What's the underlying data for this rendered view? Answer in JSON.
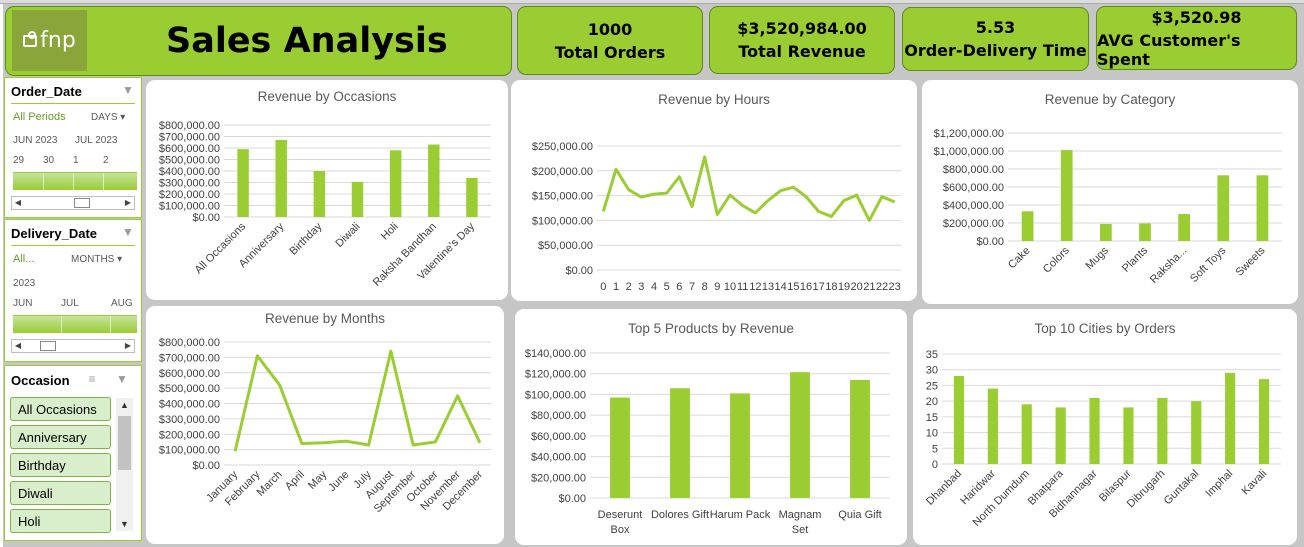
{
  "title": "Sales Analysis",
  "logo_text": "fnp",
  "colors": {
    "accent": "#9acd32",
    "line": "#9acd32",
    "panel": "#ffffff",
    "background": "#c6c6c6"
  },
  "kpis": [
    {
      "value": "1000",
      "label": "Total Orders"
    },
    {
      "value": "$3,520,984.00",
      "label": "Total Revenue"
    },
    {
      "value": "5.53",
      "label": "Order-Delivery Time"
    },
    {
      "value": "$3,520.98",
      "label": "AVG Customer's Spent"
    }
  ],
  "slicers": {
    "order_date": {
      "title": "Order_Date",
      "period": "All Periods",
      "unit": "DAYS",
      "months": [
        "JUN 2023",
        "JUL 2023"
      ],
      "days": [
        "29",
        "30",
        "1",
        "2"
      ]
    },
    "delivery_date": {
      "title": "Delivery_Date",
      "period": "All...",
      "unit": "MONTHS",
      "year": "2023",
      "months": [
        "JUN",
        "JUL",
        "AUG"
      ]
    },
    "occasion": {
      "title": "Occasion",
      "items": [
        "All Occasions",
        "Anniversary",
        "Birthday",
        "Diwali",
        "Holi"
      ]
    }
  },
  "chart_data": [
    {
      "type": "bar",
      "title": "Revenue by Occasions",
      "categories": [
        "All Occasions",
        "Anniversary",
        "Birthday",
        "Diwali",
        "Holi",
        "Raksha Bandhan",
        "Valentine's Day"
      ],
      "values": [
        590000,
        670000,
        400000,
        305000,
        580000,
        630000,
        340000
      ],
      "ylim": [
        0,
        800000
      ],
      "yticks": [
        "$0.00",
        "$100,000.00",
        "$200,000.00",
        "$300,000.00",
        "$400,000.00",
        "$500,000.00",
        "$600,000.00",
        "$700,000.00",
        "$800,000.00"
      ]
    },
    {
      "type": "line",
      "title": "Revenue by Hours",
      "x": [
        "0",
        "1",
        "2",
        "3",
        "4",
        "5",
        "6",
        "7",
        "8",
        "9",
        "10",
        "11",
        "12",
        "13",
        "14",
        "15",
        "16",
        "17",
        "18",
        "19",
        "20",
        "21",
        "22",
        "23"
      ],
      "values": [
        118000,
        203000,
        162000,
        147000,
        153000,
        155000,
        188000,
        128000,
        228000,
        112000,
        151000,
        130000,
        115000,
        140000,
        160000,
        167000,
        148000,
        118000,
        108000,
        140000,
        151000,
        100000,
        148000,
        137000
      ],
      "ylim": [
        0,
        250000
      ],
      "yticks": [
        "$0.00",
        "$50,000.00",
        "$100,000.00",
        "$150,000.00",
        "$200,000.00",
        "$250,000.00"
      ]
    },
    {
      "type": "bar",
      "title": "Revenue by Category",
      "categories": [
        "Cake",
        "Colors",
        "Mugs",
        "Plants",
        "Raksha...",
        "Soft Toys",
        "Sweets"
      ],
      "values": [
        330000,
        1010000,
        190000,
        195000,
        300000,
        730000,
        730000
      ],
      "ylim": [
        0,
        1200000
      ],
      "yticks": [
        "$0.00",
        "$200,000.00",
        "$400,000.00",
        "$600,000.00",
        "$800,000.00",
        "$1,000,000.00",
        "$1,200,000.00"
      ]
    },
    {
      "type": "line",
      "title": "Revenue by Months",
      "x": [
        "January",
        "February",
        "March",
        "April",
        "May",
        "June",
        "July",
        "August",
        "September",
        "October",
        "November",
        "December"
      ],
      "values": [
        90000,
        710000,
        520000,
        140000,
        145000,
        155000,
        130000,
        740000,
        130000,
        150000,
        450000,
        145000
      ],
      "ylim": [
        0,
        800000
      ],
      "yticks": [
        "$0.00",
        "$100,000.00",
        "$200,000.00",
        "$300,000.00",
        "$400,000.00",
        "$500,000.00",
        "$600,000.00",
        "$700,000.00",
        "$800,000.00"
      ]
    },
    {
      "type": "bar",
      "title": "Top 5 Products by Revenue",
      "categories": [
        "Deserunt Box",
        "Dolores Gift",
        "Harum Pack",
        "Magnam Set",
        "Quia Gift"
      ],
      "values": [
        97000,
        106000,
        101000,
        121500,
        114000
      ],
      "ylim": [
        0,
        140000
      ],
      "yticks": [
        "$0.00",
        "$20,000.00",
        "$40,000.00",
        "$60,000.00",
        "$80,000.00",
        "$100,000.00",
        "$120,000.00",
        "$140,000.00"
      ]
    },
    {
      "type": "bar",
      "title": "Top 10 Cities by Orders",
      "categories": [
        "Dhanbad",
        "Haridwar",
        "North Dumdum",
        "Bhatpara",
        "Bidhannagar",
        "Bilaspur",
        "Dibrugarh",
        "Guntakal",
        "Imphal",
        "Kavali"
      ],
      "values": [
        28,
        24,
        19,
        18,
        21,
        18,
        21,
        20,
        29,
        27
      ],
      "ylim": [
        0,
        35
      ],
      "yticks": [
        "0",
        "5",
        "10",
        "15",
        "20",
        "25",
        "30",
        "35"
      ]
    }
  ]
}
